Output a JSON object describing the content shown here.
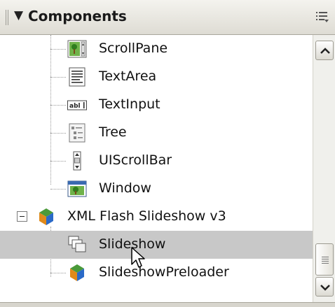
{
  "panel": {
    "title": "Components",
    "collapse_icon": "triangle-down-icon",
    "options_icon": "panel-options-icon"
  },
  "tree": {
    "items": [
      {
        "label": "ScrollPane",
        "icon": "scrollpane-icon",
        "selected": false
      },
      {
        "label": "TextArea",
        "icon": "textarea-icon",
        "selected": false
      },
      {
        "label": "TextInput",
        "icon": "textinput-icon",
        "selected": false
      },
      {
        "label": "Tree",
        "icon": "tree-icon",
        "selected": false
      },
      {
        "label": "UIScrollBar",
        "icon": "scrollbar-icon",
        "selected": false
      },
      {
        "label": "Window",
        "icon": "window-icon",
        "selected": false
      },
      {
        "label": "XML Flash Slideshow v3",
        "icon": "component-package-icon",
        "expanded": true,
        "selected": false
      },
      {
        "label": "Slideshow",
        "icon": "movieclip-stack-icon",
        "selected": true
      },
      {
        "label": "SlideshowPreloader",
        "icon": "component-package-icon",
        "selected": false
      }
    ]
  },
  "colors": {
    "selected_row": "#c8c8c8",
    "header_bg": "#dedcd4"
  }
}
